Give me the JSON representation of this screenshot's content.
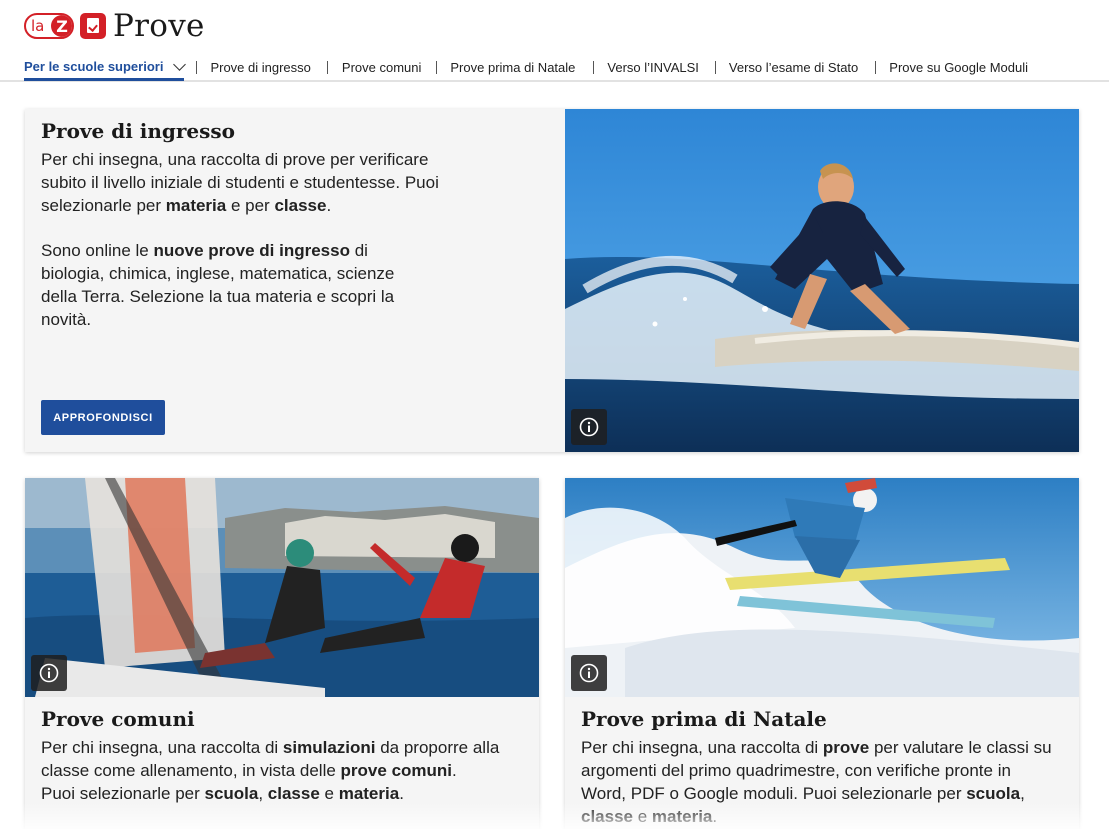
{
  "header": {
    "logo_la": "la",
    "logo_z": "Z",
    "title": "Prove",
    "accent": "#d32027"
  },
  "nav": {
    "dropdown_label": "Per le scuole superiori",
    "items": [
      "Prove di ingresso",
      "Prove comuni",
      "Prove prima di Natale",
      "Verso l’INVALSI",
      "Verso l’esame di Stato",
      "Prove su Google Moduli"
    ],
    "active_color": "#1f4e9c"
  },
  "cards": {
    "ingresso": {
      "title": "Prove di ingresso",
      "p1_a": "Per chi insegna, una raccolta di prove per verificare subito il livello iniziale di studenti e studentesse. Puoi selezionarle per ",
      "p1_b": "materia",
      "p1_c": " e per ",
      "p1_d": "classe",
      "p1_e": ".",
      "p2_a": "Sono online le ",
      "p2_b": "nuove prove di ingresso",
      "p2_c": " di biologia, chimica, inglese, matematica, scienze della Terra. Selezione la tua materia e scopri la novità.",
      "button": "APPROFONDISCI",
      "image_icon": "surfing-photo"
    },
    "comuni": {
      "title": "Prove comuni",
      "a": "Per chi insegna, una raccolta di ",
      "b": "simulazioni",
      "c": " da proporre alla classe come allenamento, in vista delle ",
      "d": "prove comuni",
      "e": ".",
      "f": "Puoi selezionarle per ",
      "g": "scuola",
      "h": ", ",
      "i": "classe",
      "j": " e ",
      "k": "materia",
      "l": ".",
      "image_icon": "sailing-photo"
    },
    "natale": {
      "title": "Prove prima di Natale",
      "a": "Per chi insegna, una raccolta di ",
      "b": "prove",
      "c": " per valutare le classi su argomenti del primo quadrimestre, con verifiche pronte in Word, PDF o Google moduli. Puoi selezionarle per ",
      "d": "scuola",
      "e": ", ",
      "f": "classe",
      "g": " e ",
      "h": "materia",
      "i": ".",
      "image_icon": "skiing-photo"
    }
  },
  "icons": {
    "info": "info-icon",
    "chevron": "chevron-down-icon",
    "logo": "zanichelli-logo"
  }
}
